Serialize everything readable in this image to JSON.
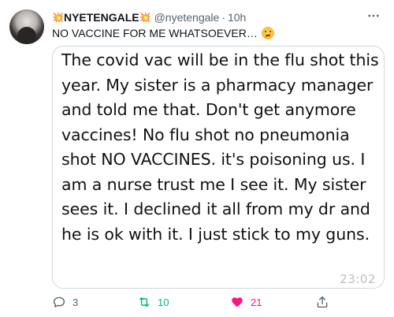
{
  "tweet": {
    "display_name": "NYETENGALE",
    "name_decoration_left": "💥",
    "name_decoration_right": "💥",
    "handle": "@nyetengale",
    "separator": "·",
    "time": "10h",
    "more_icon": "more-horizontal-icon",
    "text": "NO VACCINE FOR ME WHATSOEVER…",
    "text_emoji": "face-with-raised-eyebrow"
  },
  "media": {
    "text": "The covid vac will be in the flu shot this year. My sister is a pharmacy manager and told me that. Don't get anymore vaccines! No flu shot no pneumonia shot NO VACCINES.  it's poisoning us.  I am a nurse trust me I see it. My sister sees it.  I declined it all from my dr and he is ok with it. I just stick to my guns.",
    "timestamp": "23:02"
  },
  "actions": {
    "reply": {
      "icon": "reply-icon",
      "count": "3"
    },
    "retweet": {
      "icon": "retweet-icon",
      "count": "10",
      "color": "#00ba7c"
    },
    "like": {
      "icon": "heart-filled-icon",
      "count": "21",
      "color": "#f91880"
    },
    "share": {
      "icon": "share-icon",
      "count": ""
    }
  },
  "colors": {
    "text_primary": "#0f1419",
    "text_secondary": "#536471",
    "retweet_active": "#00ba7c",
    "like_active": "#f91880",
    "border": "#cfd9de"
  }
}
